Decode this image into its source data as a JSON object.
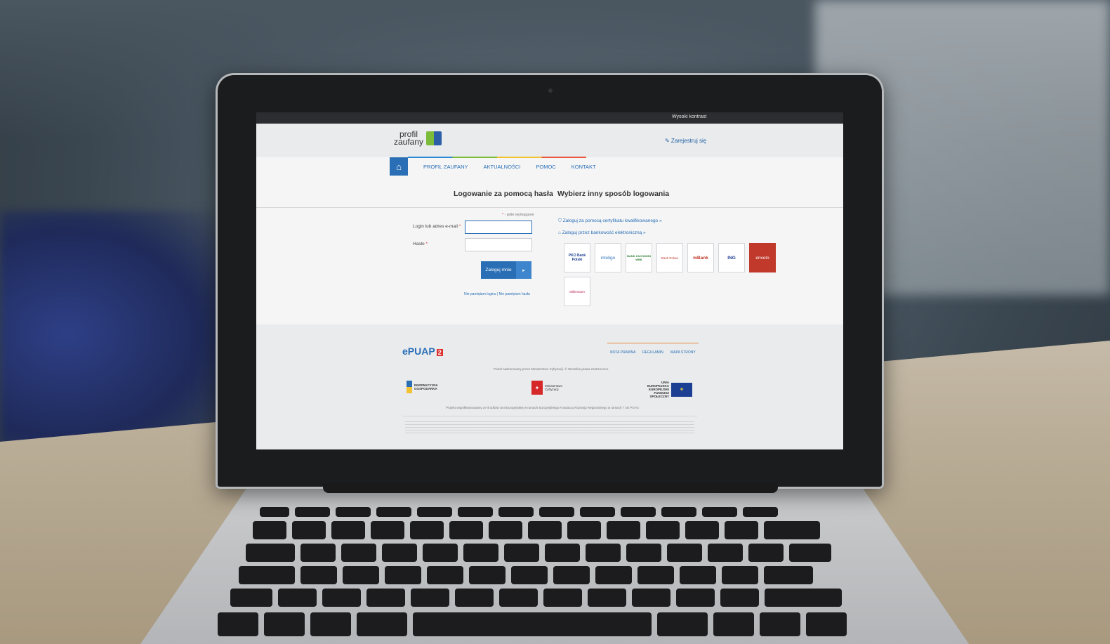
{
  "app": {
    "contrast_link": "Wysoki kontrast",
    "logo_text_1": "profil",
    "logo_text_2": "zaufany",
    "register_link": "✎ Zarejestruj się"
  },
  "nav": {
    "items": [
      "PROFIL ZAUFANY",
      "AKTUALNOŚCI",
      "POMOC",
      "KONTAKT"
    ]
  },
  "login": {
    "title": "Logowanie za pomocą hasła",
    "required_note": "- pole wymagane",
    "login_label": "Login lub adres e-mail",
    "password_label": "Hasło",
    "button_label": "Zaloguj mnie",
    "forgot_links": "Nie pamiętam loginu | Nie pamiętam hasła"
  },
  "alt_login": {
    "title": "Wybierz inny sposób logowania",
    "cert_link": "Zaloguj za pomocą certyfikatu kwalifikowanego »",
    "bank_link": "Zaloguj przez bankowość elektroniczną »",
    "banks": [
      "PKO Bank Polski",
      "inteligo",
      "BANK ZACHODNI WBK",
      "Bank Pekao",
      "mBank",
      "ING",
      "envelo",
      "Millennium"
    ]
  },
  "footer": {
    "epuap_text": "ePUAP",
    "epuap_badge": "2",
    "links": [
      "NOTA PRAWNA",
      "REGULAMIN",
      "MAPA STRONY"
    ],
    "supervision": "Portal nadzorowany przez Ministerstwo Cyfryzacji. © Wszelkie prawa zastrzeżone.",
    "logo_ig": "INNOWACYJNA GOSPODARKA",
    "logo_mc": "Ministerstwo Cyfryzacji",
    "logo_eu": "UNIA EUROPEJSKA EUROPEJSKI FUNDUSZ SPOŁECZNY",
    "cofinanced": "Projekt współfinansowany ze środków Unii Europejskiej w ramach Europejskiego Funduszu Rozwoju Regionalnego w ramach 7 osi PO IG"
  }
}
